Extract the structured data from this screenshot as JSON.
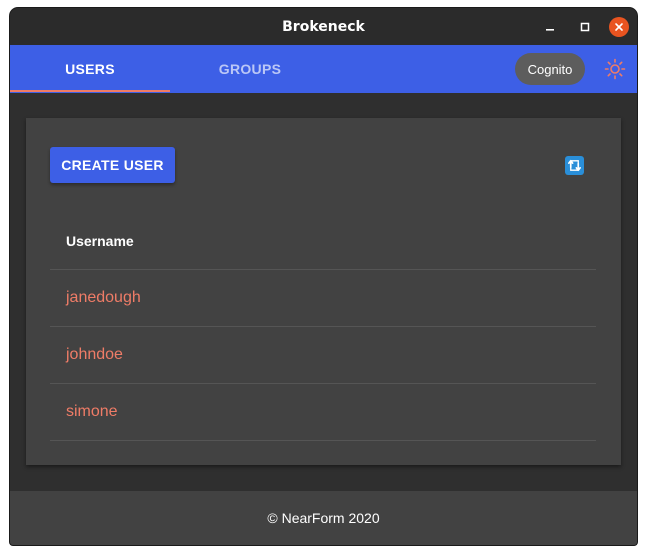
{
  "window": {
    "title": "Brokeneck"
  },
  "tabs": [
    {
      "label": "USERS",
      "active": true
    },
    {
      "label": "GROUPS",
      "active": false
    }
  ],
  "appbar": {
    "provider_chip": "Cognito",
    "theme_icon": "sun-icon"
  },
  "card": {
    "create_button": "CREATE USER",
    "refresh_icon": "refresh-icon",
    "table": {
      "header": "Username",
      "rows": [
        "janedough",
        "johndoe",
        "simone"
      ]
    }
  },
  "footer": {
    "text": "© NearForm 2020"
  },
  "colors": {
    "primary": "#3d5fe6",
    "accent": "#ef7c67",
    "surface": "#424242",
    "background": "#2f2f2f",
    "close_button": "#e95420"
  }
}
